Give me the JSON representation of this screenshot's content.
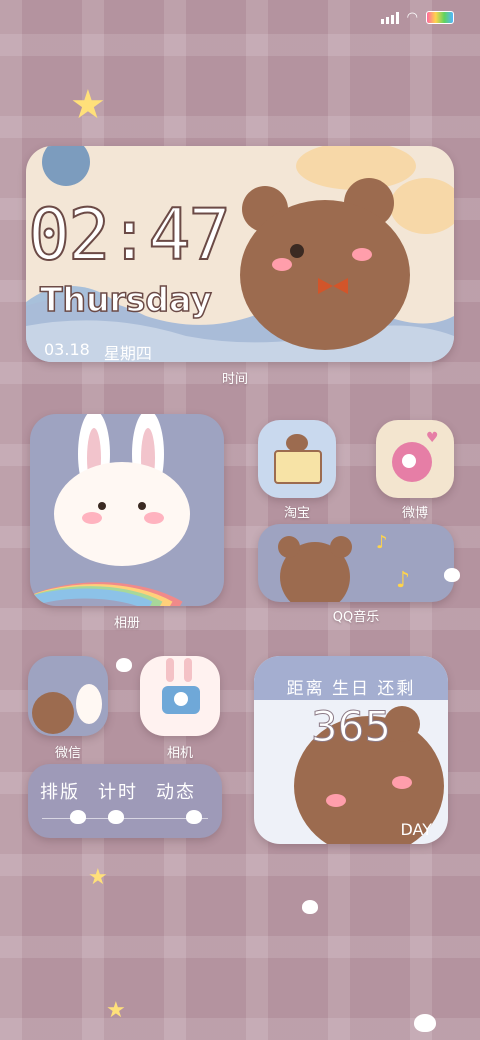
{
  "clock": {
    "time": "02:47",
    "weekday": "Thursday",
    "date": "03.18",
    "cn_weekday": "星期四",
    "label": "时间"
  },
  "apps": {
    "photos": "相册",
    "taobao": "淘宝",
    "weibo": "微博",
    "qq_music": "QQ音乐",
    "wechat": "微信",
    "camera": "相机"
  },
  "text_widget": {
    "items": [
      "排版",
      "计时",
      "动态"
    ]
  },
  "countdown": {
    "title": "距离 生日 还剩",
    "value": "365",
    "unit": "DAY"
  }
}
